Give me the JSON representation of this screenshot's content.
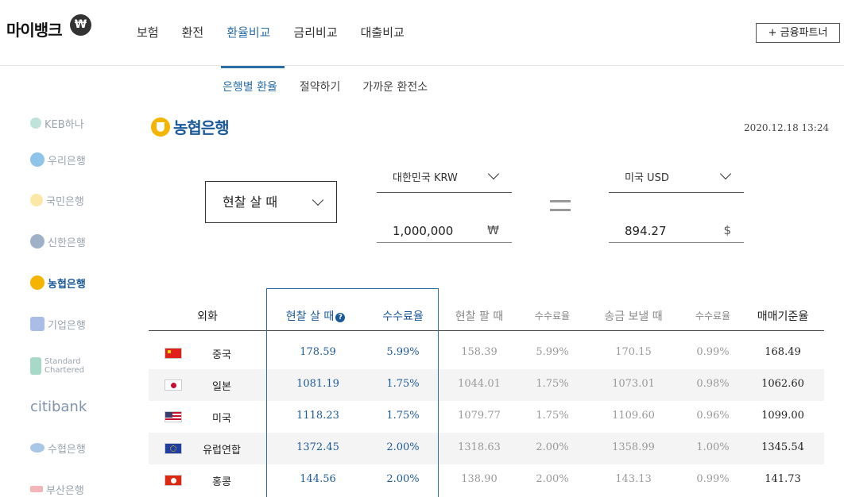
{
  "header": {
    "logo": "마이뱅크",
    "logo_symbol": "₩",
    "nav": [
      "보험",
      "환전",
      "환율비교",
      "금리비교",
      "대출비교"
    ],
    "active_nav": "환율비교",
    "partner_button": "+ 금융파트너"
  },
  "subtabs": [
    "은행별 환율",
    "절약하기",
    "가까운 환전소"
  ],
  "sidebar": {
    "banks": [
      "KEB하나",
      "우리은행",
      "국민은행",
      "신한은행",
      "농협은행",
      "기업은행",
      "Standard Chartered",
      "citibank",
      "수협은행",
      "부산은행"
    ],
    "active_bank": "농협은행"
  },
  "main": {
    "bank_name": "농협은행",
    "datetime": "2020.12.18 13:24",
    "type_select": "현찰 살 때",
    "from_currency": "대한민국 KRW",
    "from_amount": "1,000,000",
    "from_symbol": "₩",
    "to_currency": "미국 USD",
    "to_amount": "894.27",
    "to_symbol": "$"
  },
  "table": {
    "headers": [
      "외화",
      "현찰 살 때",
      "수수료율",
      "현찰 팔 때",
      "수수료율",
      "송금 보낼 때",
      "수수료율",
      "매매기준율"
    ],
    "rows": [
      {
        "name": "중국",
        "flag": "china-flag",
        "buy": "178.59",
        "buy_fee": "5.99%",
        "sell": "158.39",
        "sell_fee": "5.99%",
        "send": "170.15",
        "send_fee": "0.99%",
        "base": "168.49"
      },
      {
        "name": "일본",
        "flag": "japan-flag",
        "buy": "1081.19",
        "buy_fee": "1.75%",
        "sell": "1044.01",
        "sell_fee": "1.75%",
        "send": "1073.01",
        "send_fee": "0.98%",
        "base": "1062.60"
      },
      {
        "name": "미국",
        "flag": "usa-flag",
        "buy": "1118.23",
        "buy_fee": "1.75%",
        "sell": "1079.77",
        "sell_fee": "1.75%",
        "send": "1109.60",
        "send_fee": "0.96%",
        "base": "1099.00"
      },
      {
        "name": "유럽연합",
        "flag": "eu-flag",
        "buy": "1372.45",
        "buy_fee": "2.00%",
        "sell": "1318.63",
        "sell_fee": "2.00%",
        "send": "1358.99",
        "send_fee": "1.00%",
        "base": "1345.54"
      },
      {
        "name": "홍콩",
        "flag": "hongkong-flag",
        "buy": "144.56",
        "buy_fee": "2.00%",
        "sell": "138.90",
        "sell_fee": "2.00%",
        "send": "143.13",
        "send_fee": "0.99%",
        "base": "141.73"
      }
    ]
  },
  "colors": {
    "accent": "#2a6ea8",
    "bank_blue": "#1b5a9a",
    "nh_yellow": "#f5b400"
  }
}
